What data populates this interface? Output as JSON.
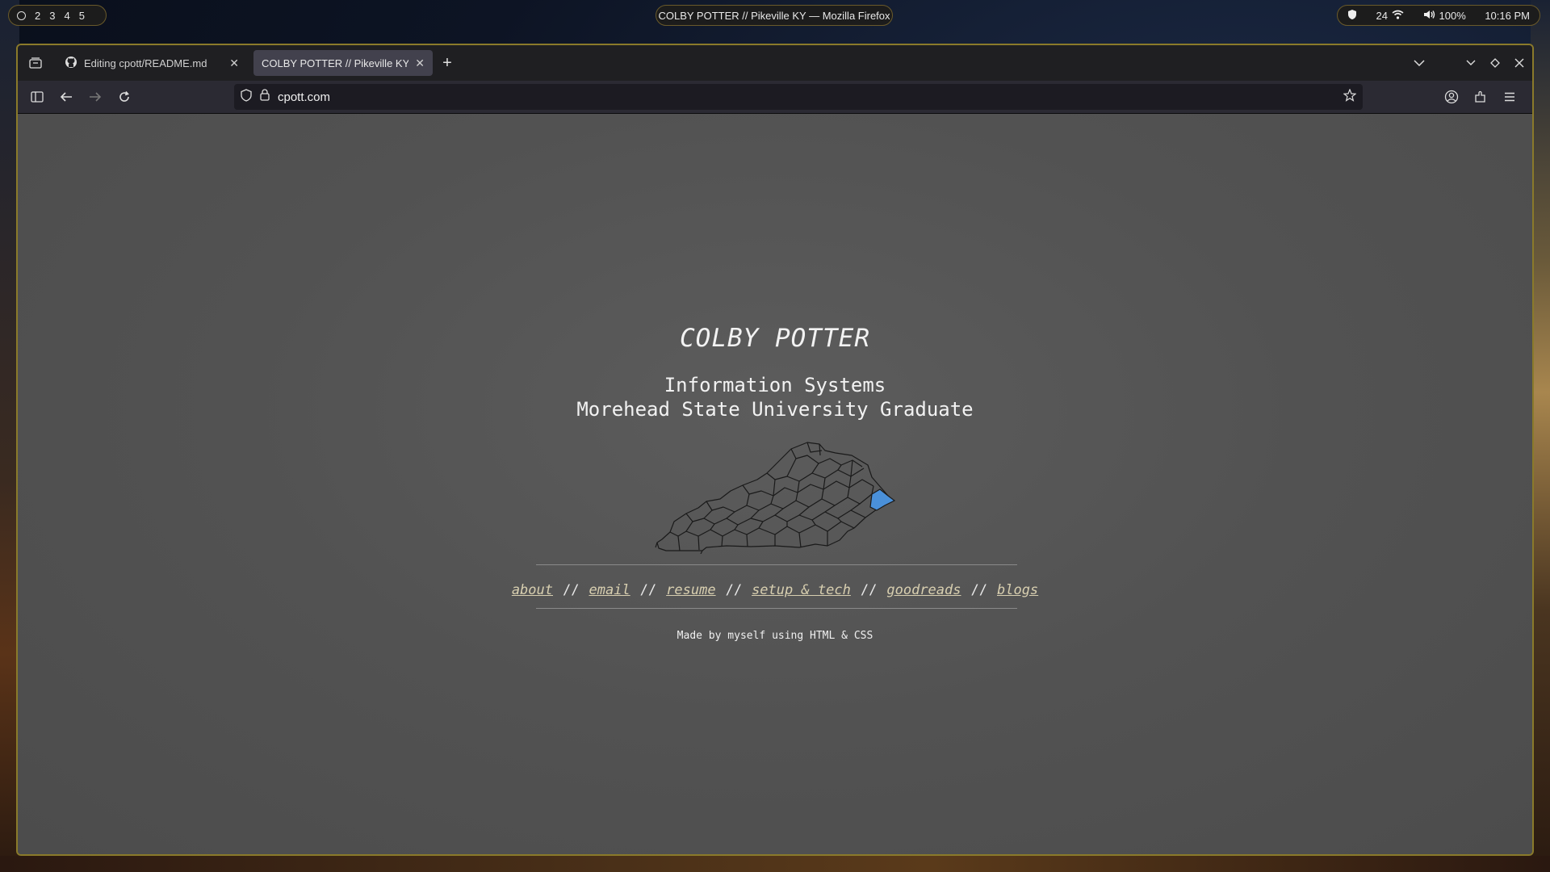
{
  "desktop": {
    "workspaces": [
      "2",
      "3",
      "4",
      "5"
    ],
    "window_title": "COLBY POTTER // Pikeville KY — Mozilla Firefox",
    "tray": {
      "temp": "24",
      "volume": "100%",
      "time": "10:16 PM"
    }
  },
  "browser": {
    "tabs": [
      {
        "label": "Editing cpott/README.md",
        "icon": "github-icon"
      },
      {
        "label": "COLBY POTTER // Pikeville KY",
        "active": true
      }
    ],
    "url": "cpott.com"
  },
  "page": {
    "name": "COLBY POTTER",
    "subtitle_1": "Information Systems",
    "subtitle_2": "Morehead State University Graduate",
    "map_highlight_color": "#4a90d9",
    "links": [
      "about",
      "email",
      "resume",
      "setup & tech",
      "goodreads",
      "blogs"
    ],
    "separator": "//",
    "footer": "Made by myself using HTML & CSS"
  }
}
